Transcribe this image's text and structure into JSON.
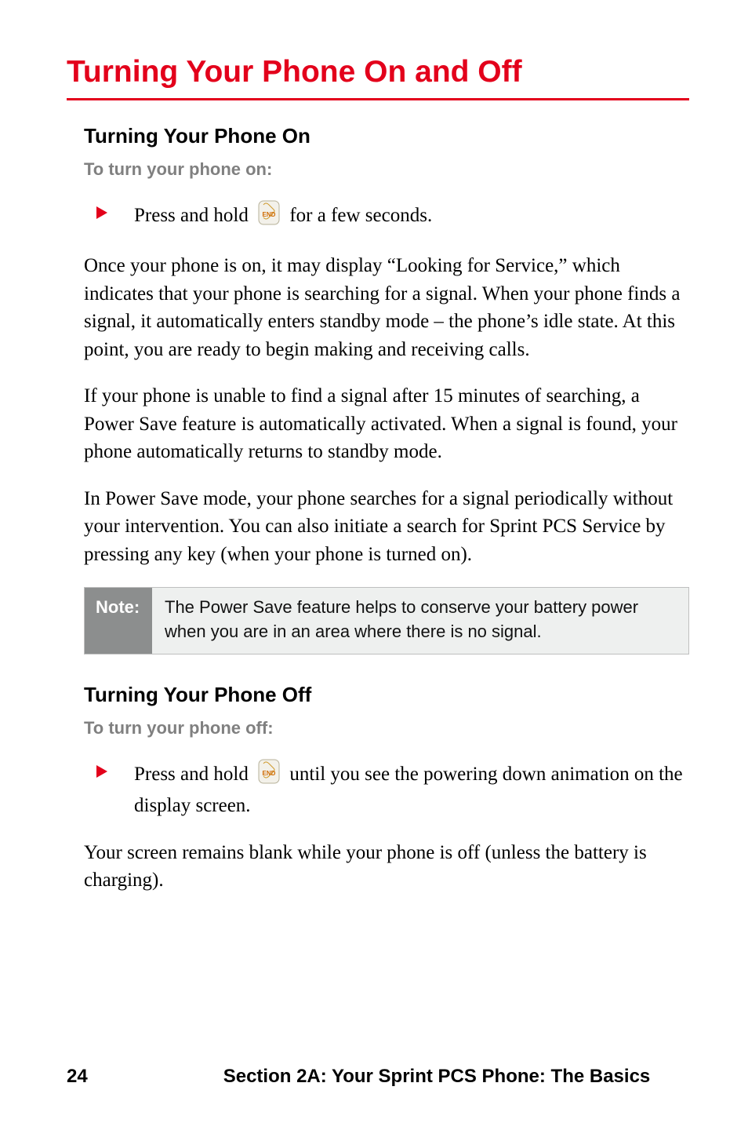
{
  "title": "Turning Your Phone On and Off",
  "section_on": {
    "heading": "Turning Your Phone On",
    "lead": "To turn your phone on:",
    "bullet_pre": "Press and hold ",
    "bullet_post": " for a few seconds.",
    "key_name": "end-key-icon",
    "para1": "Once your phone is on, it may display “Looking for Service,” which indicates that your phone is searching for a signal. When your phone finds a signal, it automatically enters standby mode – the phone’s idle state. At this point, you are ready to begin making and receiving calls.",
    "para2": "If your phone is unable to find a signal after 15 minutes of searching, a Power Save feature is automatically activated. When a signal is found, your phone automatically returns to standby mode.",
    "para3": "In Power Save mode, your phone searches for a signal periodically without your intervention. You can also initiate a search for Sprint PCS Service by pressing any key (when your phone is turned on)."
  },
  "note": {
    "label": "Note:",
    "text": "The Power Save feature helps to conserve your battery power when you are in an area where there is no signal."
  },
  "section_off": {
    "heading": "Turning Your Phone Off",
    "lead": "To turn your phone off:",
    "bullet_pre": "Press and hold ",
    "bullet_post": " until you see the powering down animation on the display screen.",
    "key_name": "end-key-icon",
    "para1": "Your screen remains blank while your phone is off (unless the battery is charging)."
  },
  "footer": {
    "page": "24",
    "section": "Section 2A: Your Sprint PCS Phone: The Basics"
  },
  "colors": {
    "accent": "#e3001b",
    "note_bg": "#eef0ef",
    "note_label_bg": "#8c8e8e"
  }
}
